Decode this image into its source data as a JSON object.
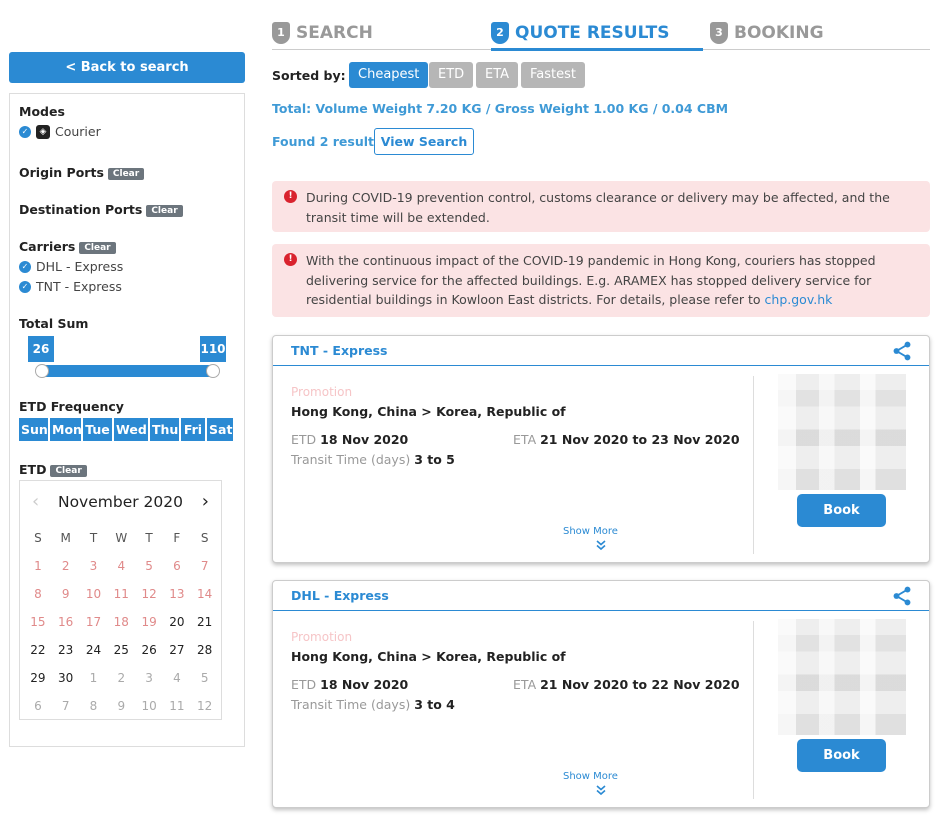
{
  "sidebar": {
    "back_label": "< Back to search",
    "modes": {
      "title": "Modes",
      "items": [
        {
          "label": "Courier",
          "icon": "package-icon"
        }
      ]
    },
    "origin_ports": {
      "title": "Origin Ports",
      "clear": "Clear"
    },
    "destination_ports": {
      "title": "Destination Ports",
      "clear": "Clear"
    },
    "carriers": {
      "title": "Carriers",
      "clear": "Clear",
      "items": [
        "DHL - Express",
        "TNT - Express"
      ]
    },
    "total_sum": {
      "title": "Total Sum",
      "min": "26",
      "max": "110"
    },
    "etd_frequency": {
      "title": "ETD Frequency",
      "days": [
        "Sun",
        "Mon",
        "Tue",
        "Wed",
        "Thu",
        "Fri",
        "Sat"
      ]
    },
    "etd": {
      "title": "ETD",
      "clear": "Clear"
    },
    "calendar": {
      "month_label": "November 2020",
      "weekdays": [
        "S",
        "M",
        "T",
        "W",
        "T",
        "F",
        "S"
      ],
      "weeks": [
        [
          "1",
          "2",
          "3",
          "4",
          "5",
          "6",
          "7"
        ],
        [
          "8",
          "9",
          "10",
          "11",
          "12",
          "13",
          "14"
        ],
        [
          "15",
          "16",
          "17",
          "18",
          "19",
          "20",
          "21"
        ],
        [
          "22",
          "23",
          "24",
          "25",
          "26",
          "27",
          "28"
        ],
        [
          "29",
          "30",
          "1",
          "2",
          "3",
          "4",
          "5"
        ],
        [
          "6",
          "7",
          "8",
          "9",
          "10",
          "11",
          "12"
        ]
      ]
    }
  },
  "steps": [
    {
      "num": "1",
      "label": "SEARCH"
    },
    {
      "num": "2",
      "label": "QUOTE RESULTS"
    },
    {
      "num": "3",
      "label": "BOOKING"
    }
  ],
  "sort": {
    "label": "Sorted by:",
    "options": [
      "Cheapest",
      "ETD",
      "ETA",
      "Fastest"
    ],
    "active": "Cheapest"
  },
  "summary": {
    "total": "Total: Volume Weight 7.20 KG / Gross Weight 1.00 KG / 0.04 CBM",
    "found": "Found 2 results",
    "view_search": "View Search"
  },
  "alerts": [
    {
      "text": "During COVID-19 prevention control, customs clearance or delivery may be affected, and the transit time will be extended."
    },
    {
      "text": "With the continuous impact of the COVID-19 pandemic in Hong Kong, couriers has stopped delivering service for the affected buildings. E.g. ARAMEX has stopped delivery service for residential buildings in Kowloon East districts. For details, please refer to ",
      "link": "chp.gov.hk"
    }
  ],
  "results": [
    {
      "carrier": "TNT - Express",
      "promotion": "Promotion",
      "route": "Hong Kong, China > Korea, Republic of",
      "etd_label": "ETD",
      "etd": "18 Nov 2020",
      "eta_label": "ETA",
      "eta": "21 Nov 2020 to 23 Nov 2020",
      "transit_label": "Transit Time (days)",
      "transit": "3 to 5",
      "book": "Book",
      "show_more": "Show More"
    },
    {
      "carrier": "DHL - Express",
      "promotion": "Promotion",
      "route": "Hong Kong, China > Korea, Republic of",
      "etd_label": "ETD",
      "etd": "18 Nov 2020",
      "eta_label": "ETA",
      "eta": "21 Nov 2020 to 22 Nov 2020",
      "transit_label": "Transit Time (days)",
      "transit": "3 to 4",
      "book": "Book",
      "show_more": "Show More"
    }
  ],
  "colors": {
    "accent": "#2b8ad3",
    "alert_bg": "#fbe3e4",
    "alert_icon": "#d9232e",
    "muted_button": "#b6b6b6"
  }
}
